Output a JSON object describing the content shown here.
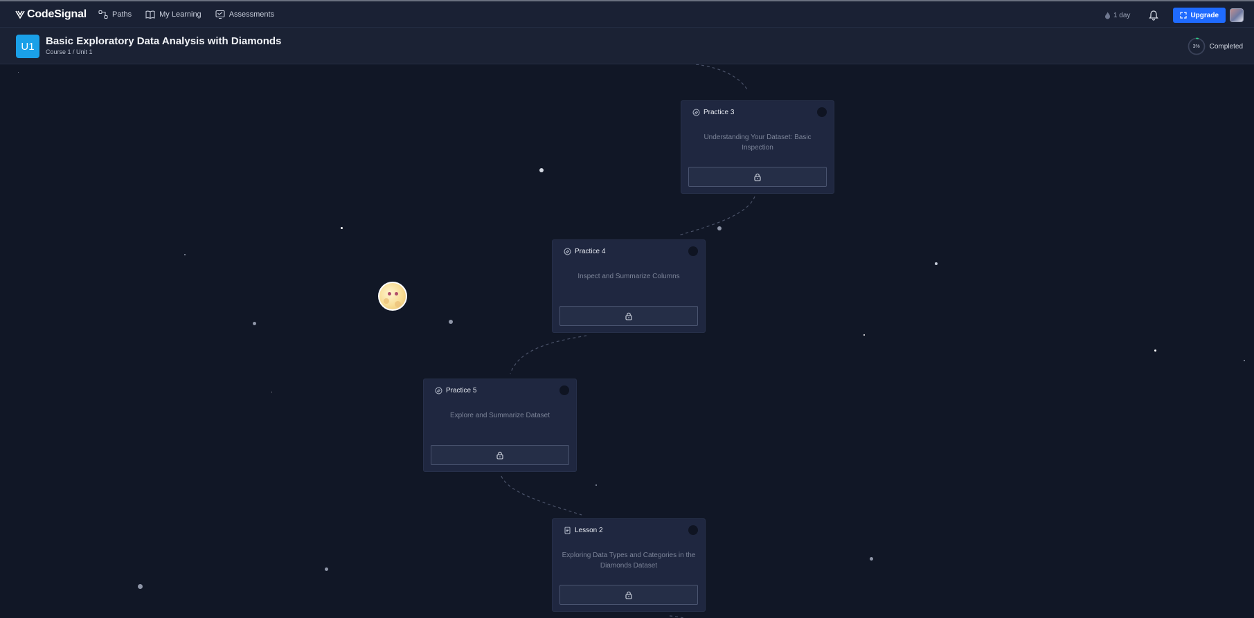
{
  "app": {
    "brand": "CodeSignal"
  },
  "nav": {
    "items": [
      {
        "label": "Paths",
        "icon": "paths-icon"
      },
      {
        "label": "My Learning",
        "icon": "book-icon"
      },
      {
        "label": "Assessments",
        "icon": "assessment-icon"
      }
    ]
  },
  "header_right": {
    "streak": "1 day",
    "upgrade_label": "Upgrade"
  },
  "unit": {
    "badge": "U1",
    "title": "Basic Exploratory Data Analysis with Diamonds",
    "subtitle": "Course 1 / Unit 1",
    "progress_percent": 3,
    "progress_text": "3%",
    "progress_label": "Completed"
  },
  "cards": [
    {
      "type": "Practice 3",
      "icon": "practice-icon",
      "description": "Understanding Your Dataset: Basic Inspection",
      "locked": true
    },
    {
      "type": "Practice 4",
      "icon": "practice-icon",
      "description": "Inspect and Summarize Columns",
      "locked": true
    },
    {
      "type": "Practice 5",
      "icon": "practice-icon",
      "description": "Explore and Summarize Dataset",
      "locked": true
    },
    {
      "type": "Lesson 2",
      "icon": "lesson-icon",
      "description": "Exploring Data Types and Categories in the Diamonds Dataset",
      "locked": true
    }
  ],
  "colors": {
    "background": "#111726",
    "topbar": "#1a2134",
    "card": "#1f2740",
    "accent": "#1f6bff",
    "unit_badge": "#1aa0e8"
  }
}
